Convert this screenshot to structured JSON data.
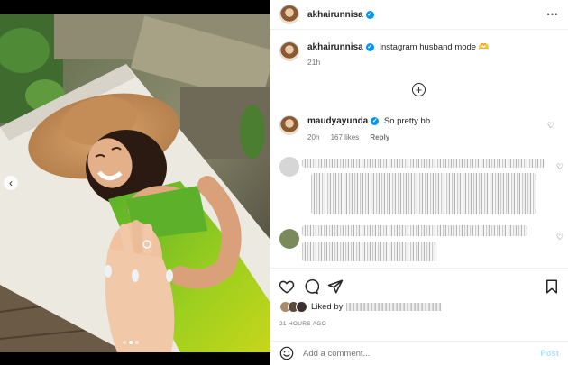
{
  "post": {
    "username": "akhairunnisa",
    "more_icon": "⋯",
    "caption_user": "akhairunnisa",
    "caption_text": "Instagram husband mode",
    "caption_emoji": "🫶",
    "caption_time": "21h"
  },
  "comments": [
    {
      "username": "maudyayunda",
      "text": "So pretty bb",
      "time": "20h",
      "likes": "167 likes",
      "reply": "Reply"
    }
  ],
  "likes": {
    "prefix": "Liked by"
  },
  "timestamp": "21 HOURS AGO",
  "add_comment": {
    "placeholder": "Add a comment...",
    "post_label": "Post"
  },
  "carousel": {
    "prev_glyph": "‹",
    "total_slides": 3,
    "active_slide": 2
  },
  "colors": {
    "link": "#0095f6",
    "post_disabled": "#b2dffc",
    "text": "#262626",
    "muted": "#737373"
  }
}
